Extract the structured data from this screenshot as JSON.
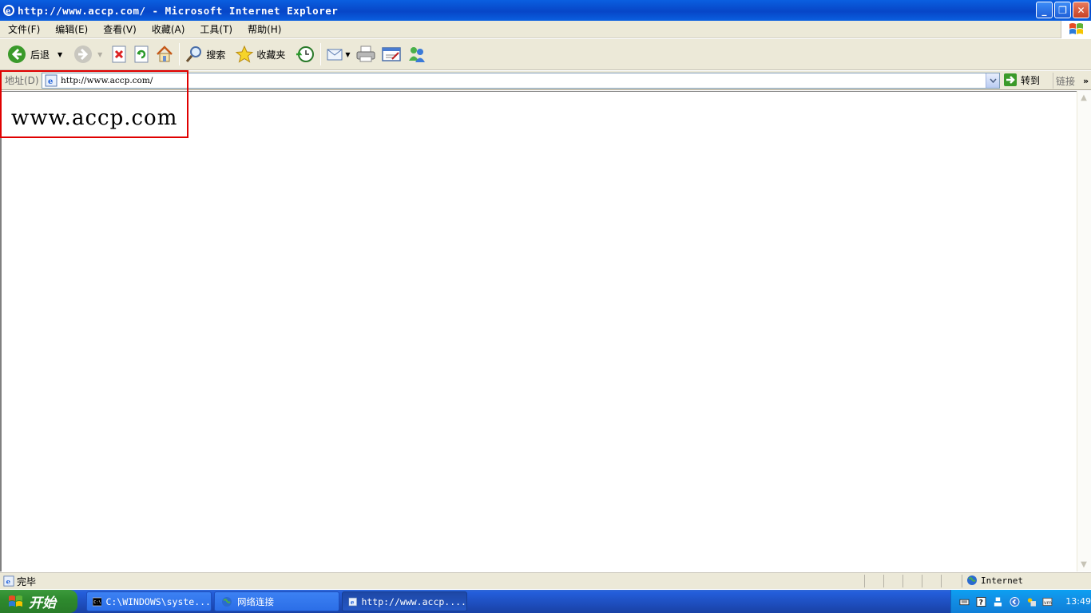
{
  "window": {
    "title": "http://www.accp.com/ - Microsoft Internet Explorer",
    "minimize": "_",
    "restore": "❐",
    "close": "✕"
  },
  "menu": {
    "items": [
      "文件(F)",
      "编辑(E)",
      "查看(V)",
      "收藏(A)",
      "工具(T)",
      "帮助(H)"
    ]
  },
  "toolbar": {
    "back_label": "后退",
    "search_label": "搜索",
    "favorites_label": "收藏夹"
  },
  "address": {
    "label": "地址(D)",
    "url": "http://www.accp.com/",
    "go_label": "转到",
    "links_label": "链接",
    "more": "»"
  },
  "page": {
    "heading": "www.accp.com"
  },
  "status": {
    "text": "完毕",
    "zone": "Internet"
  },
  "taskbar": {
    "start_label": "开始",
    "tasks": [
      "C:\\WINDOWS\\syste...",
      "网络连接",
      "http://www.accp...."
    ],
    "clock": "13:49"
  },
  "colors": {
    "title_bar": "#0a5fe0",
    "chrome": "#ece9d8",
    "highlight_box": "#e00000",
    "taskbar": "#245edb",
    "start_button": "#2e8a2e"
  }
}
